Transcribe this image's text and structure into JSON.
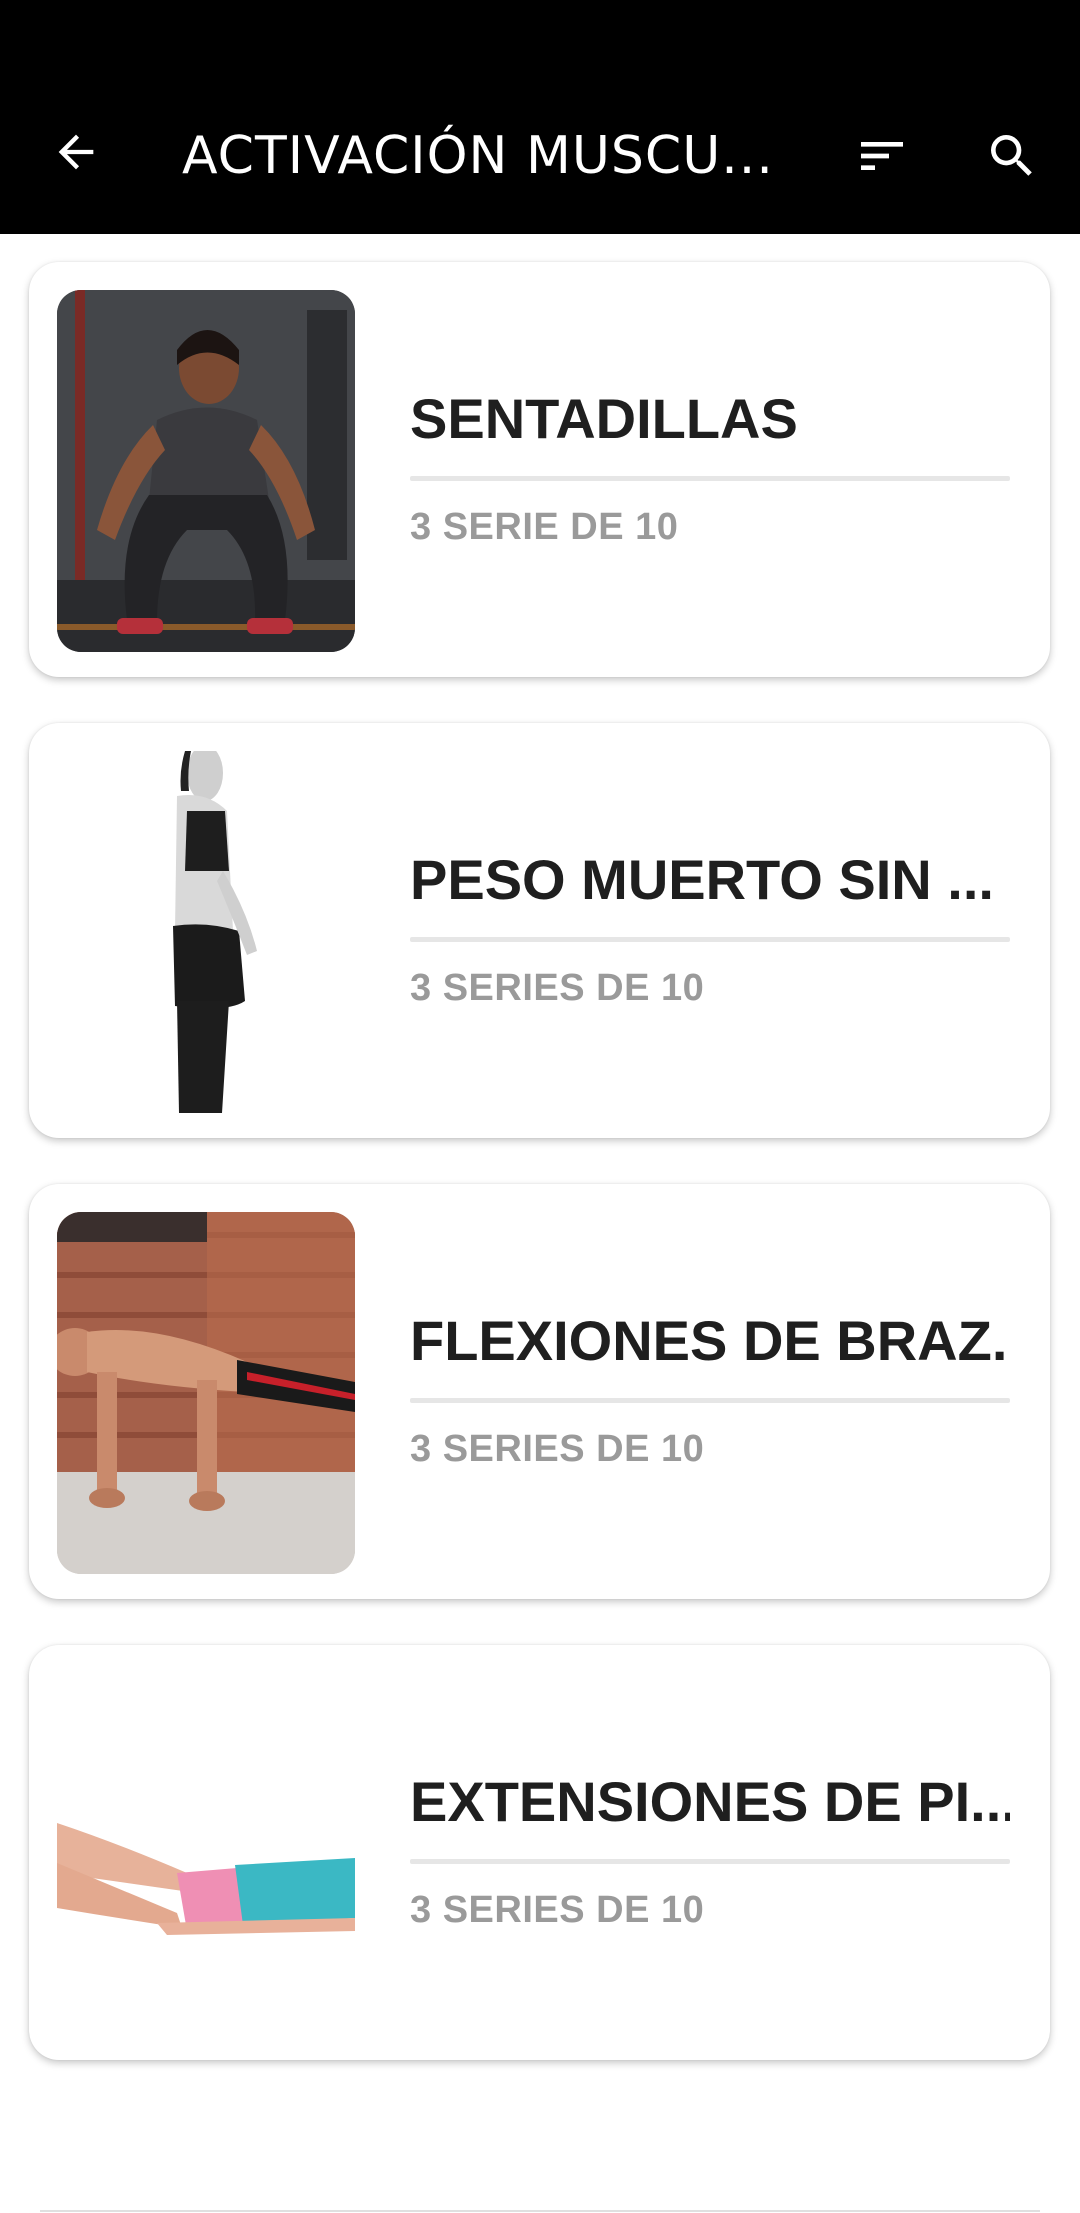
{
  "app_bar": {
    "title": "ACTIVACIÓN MUSCU...",
    "back_icon": "arrow-left-icon",
    "sort_icon": "sort-icon",
    "search_icon": "search-icon",
    "background": "#000000"
  },
  "exercises": [
    {
      "title": "SENTADILLAS",
      "subtitle": "3 SERIE DE 10",
      "image": "woman-squatting-image"
    },
    {
      "title": "PESO MUERTO SIN ...",
      "subtitle": "3 SERIES DE 10",
      "image": "woman-standing-side-image"
    },
    {
      "title": "FLEXIONES DE BRAZ...",
      "subtitle": "3 SERIES DE 10",
      "image": "man-pushup-image"
    },
    {
      "title": "EXTENSIONES DE PI...",
      "subtitle": "3 SERIES DE 10",
      "image": "woman-lying-leg-extension-image"
    }
  ]
}
